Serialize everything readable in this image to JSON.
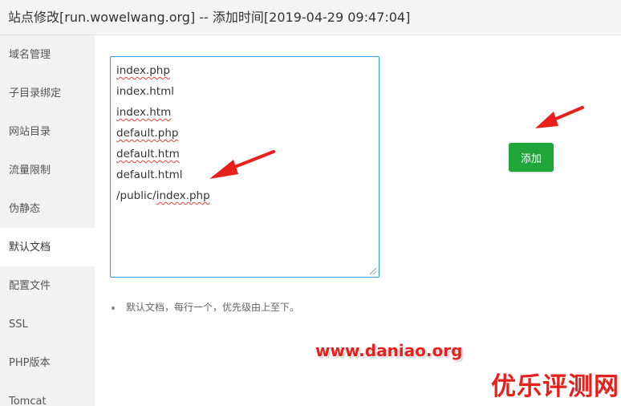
{
  "window": {
    "title": "站点修改[run.wowelwang.org] -- 添加时间[2019-04-29 09:47:04]"
  },
  "sidebar": {
    "items": [
      {
        "label": "域名管理",
        "active": false
      },
      {
        "label": "子目录绑定",
        "active": false
      },
      {
        "label": "网站目录",
        "active": false
      },
      {
        "label": "流量限制",
        "active": false
      },
      {
        "label": "伪静态",
        "active": false
      },
      {
        "label": "默认文档",
        "active": true
      },
      {
        "label": "配置文件",
        "active": false
      },
      {
        "label": "SSL",
        "active": false
      },
      {
        "label": "PHP版本",
        "active": false
      },
      {
        "label": "Tomcat",
        "active": false
      }
    ]
  },
  "editor": {
    "lines": [
      "index.php",
      "index.html",
      "index.htm",
      "default.php",
      "default.htm",
      "default.html",
      "/public/index.php"
    ],
    "line7_prefix": "/public/",
    "line7_suffix": "index.php"
  },
  "add_button": {
    "label": "添加"
  },
  "hint": {
    "text": "默认文档，每行一个，优先级由上至下。"
  },
  "watermark": {
    "text": "www.daniao.org"
  },
  "brand": {
    "text": "优乐评测网"
  },
  "colors": {
    "accent_green": "#20a53a",
    "focus_blue": "#2d9fe8",
    "arrow_red": "#e8201c"
  }
}
